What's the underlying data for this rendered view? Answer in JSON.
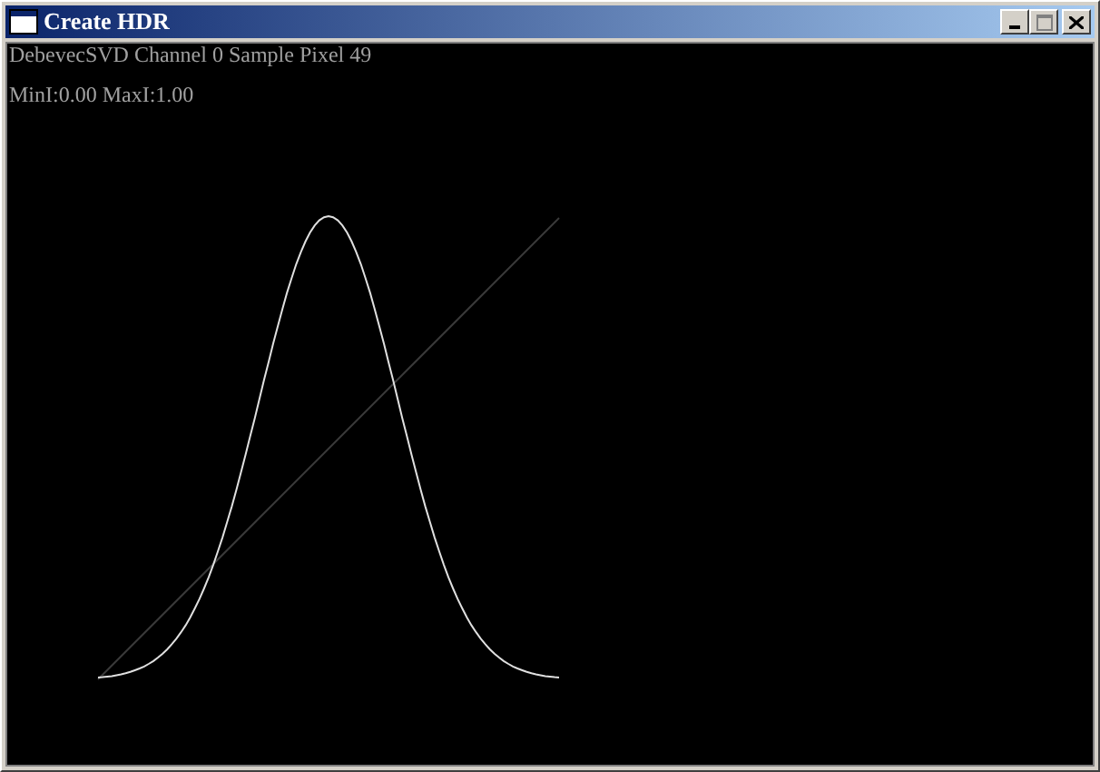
{
  "window": {
    "title": "Create HDR",
    "buttons": [
      {
        "kind": "minimize",
        "disabled": false
      },
      {
        "kind": "maximize",
        "disabled": true
      },
      {
        "kind": "close",
        "disabled": false
      }
    ]
  },
  "info_lines": [
    "DebevecSVD Channel 0 Sample Pixel 49",
    "MinI:0.00 MaxI:1.00"
  ]
}
